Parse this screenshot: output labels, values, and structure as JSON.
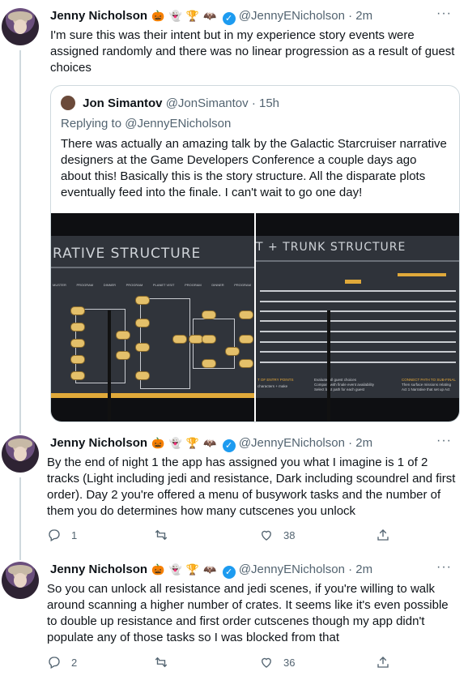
{
  "tweets": [
    {
      "name": "Jenny Nicholson",
      "emojis": [
        "🎃",
        "👻",
        "🏆",
        "🦇"
      ],
      "handle": "@JennyENicholson",
      "time": "2m",
      "text": "I'm sure this was their intent but in my experience story events were assigned randomly and there was no linear progression as a result of guest choices",
      "quote": {
        "name": "Jon Simantov",
        "handle": "@JonSimantov",
        "time": "15h",
        "reply_prefix": "Replying to",
        "reply_to": "@JennyENicholson",
        "text": "There was actually an amazing talk by the Galactic Starcruiser narrative designers at the Game Developers Conference a couple days ago about this! Basically this is the story structure. All the disparate plots eventually feed into the finale. I can't wait to go one day!",
        "images": [
          {
            "title": "RATIVE STRUCTURE",
            "labels": [
              "MUSTER",
              "PROGRAM",
              "DINNER",
              "PROGRAM",
              "PLANET VISIT",
              "PROGRAM",
              "DINNER",
              "PROGRAM"
            ]
          },
          {
            "title": "T + TRUNK STRUCTURE",
            "labels": [
              "T OF ENTRY POINTS",
              "characters + make",
              "Evaluate all guest choices",
              "Compare with finale event availability",
              "Select best path for each guest",
              "CONNECT PATH TO SUB-FINAL",
              "Then surface missions relating",
              "Act 1 Narrative that set up Act"
            ]
          }
        ]
      }
    },
    {
      "name": "Jenny Nicholson",
      "emojis": [
        "🎃",
        "👻",
        "🏆",
        "🦇"
      ],
      "handle": "@JennyENicholson",
      "time": "2m",
      "text": "By the end of night 1 the app has assigned you what I imagine is 1 of 2 tracks (Light including jedi and resistance, Dark including scoundrel and first order). Day 2 you're offered a menu of busywork tasks and the number of them you do determines how many cutscenes you unlock",
      "replies": "1",
      "retweets": "",
      "likes": "38"
    },
    {
      "name": "Jenny Nicholson",
      "emojis": [
        "🎃",
        "👻",
        "🏆",
        "🦇"
      ],
      "handle": "@JennyENicholson",
      "time": "2m",
      "text": "So you can unlock all resistance and jedi scenes, if you're willing to walk around scanning a higher number of crates. It seems like it's even possible to double up resistance and first order cutscenes though my app didn't populate any of those tasks so I was blocked from that",
      "replies": "2",
      "retweets": "",
      "likes": "36"
    }
  ],
  "icons": {
    "more": "more-horizontal-icon",
    "verified": "verified-badge-icon",
    "reply": "reply-icon",
    "retweet": "retweet-icon",
    "like": "like-icon",
    "share": "share-icon"
  },
  "colors": {
    "accent": "#1d9bf0",
    "muted": "#536471",
    "border": "#cfd9de"
  }
}
